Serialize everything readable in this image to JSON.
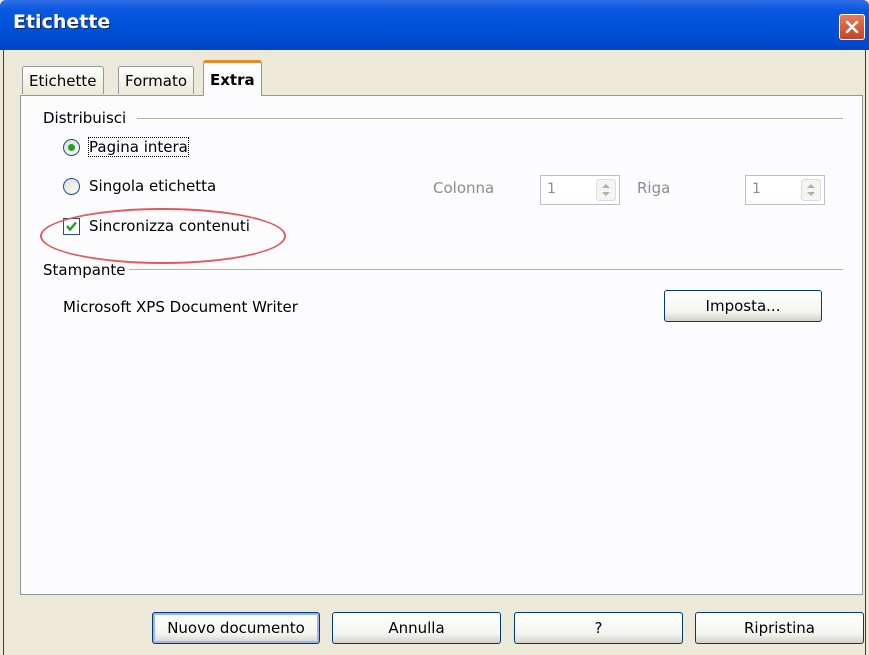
{
  "window": {
    "title": "Etichette"
  },
  "tabs": [
    {
      "label": "Etichette"
    },
    {
      "label": "Formato"
    },
    {
      "label": "Extra"
    }
  ],
  "distribute": {
    "group_label": "Distribuisci",
    "whole_page": "Pagina intera",
    "single_label": "Singola etichetta",
    "sync_contents": "Sincronizza contenuti",
    "column_label": "Colonna",
    "column_value": "1",
    "row_label": "Riga",
    "row_value": "1"
  },
  "printer": {
    "group_label": "Stampante",
    "name": "Microsoft XPS Document Writer",
    "setup_button": "Imposta..."
  },
  "buttons": {
    "new_document": "Nuovo documento",
    "cancel": "Annulla",
    "help": "?",
    "reset": "Ripristina"
  },
  "colors": {
    "highlight_ellipse": "#e8575a",
    "active_tab_accent": "#e68b2c"
  }
}
